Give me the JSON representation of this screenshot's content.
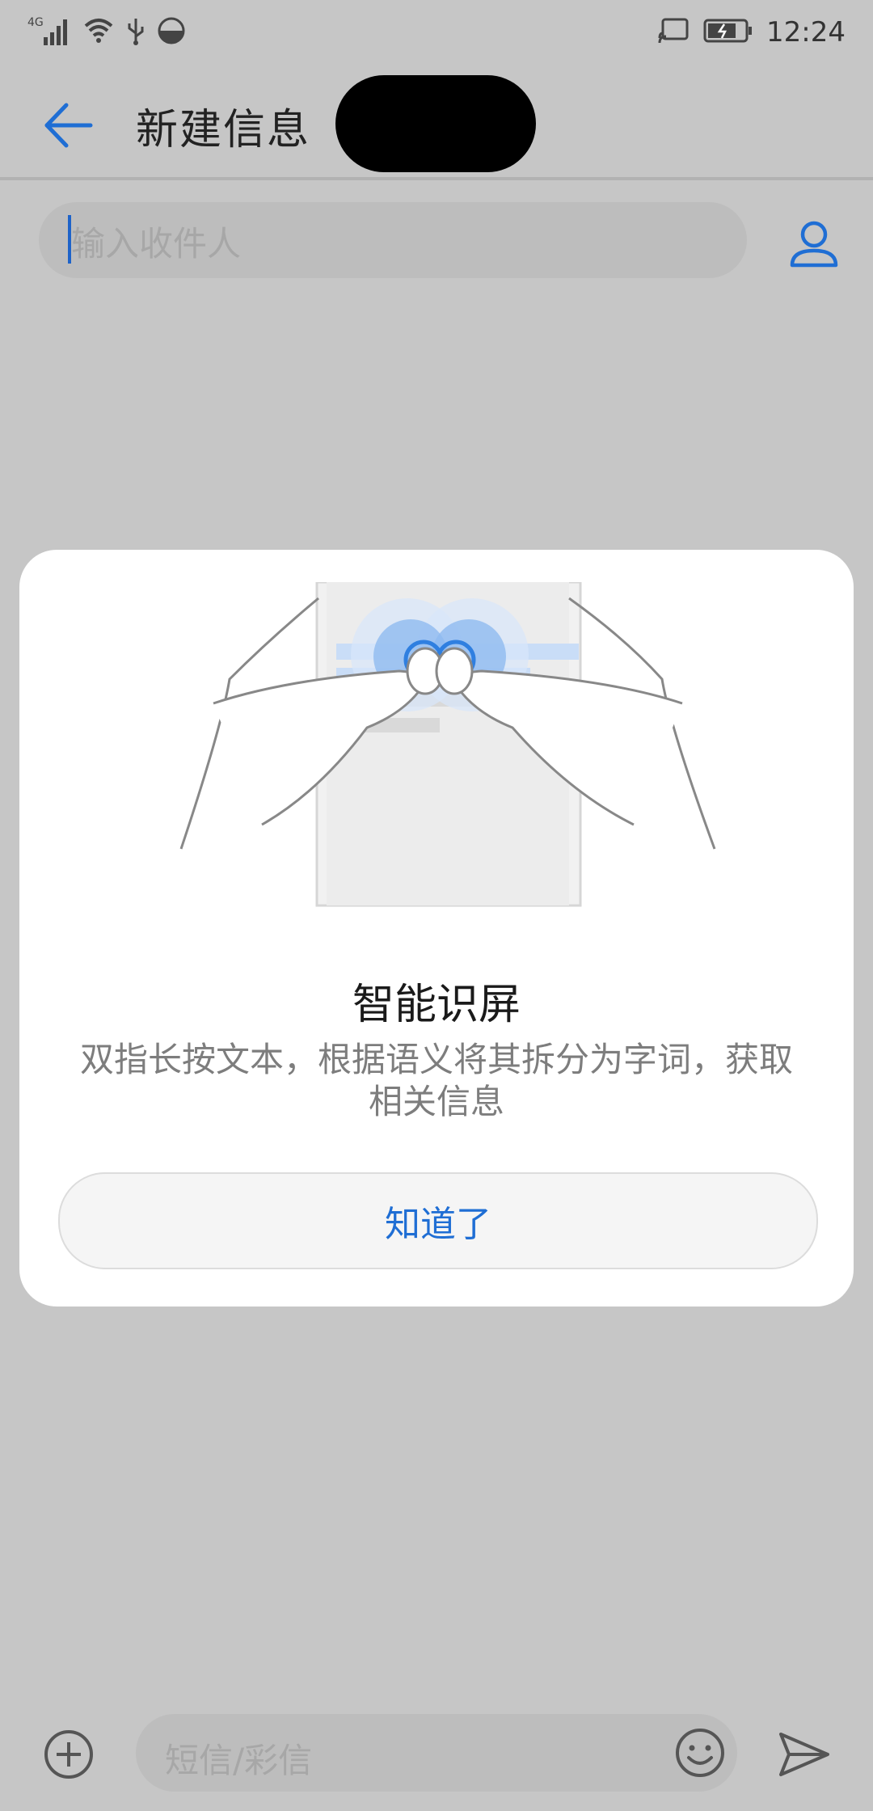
{
  "status_bar": {
    "network": "4G",
    "time": "12:24"
  },
  "header": {
    "title": "新建信息"
  },
  "recipient": {
    "placeholder": "输入收件人"
  },
  "dialog": {
    "title": "智能识屏",
    "description": "双指长按文本，根据语义将其拆分为字词，获取相关信息",
    "ok_label": "知道了"
  },
  "composer": {
    "placeholder": "短信/彩信"
  },
  "colors": {
    "accent": "#1f6ed4",
    "overlay": "#c6c6c6",
    "dialog_bg": "#ffffff"
  },
  "icons": [
    "signal-icon",
    "wifi-icon",
    "usb-icon",
    "data-saver-icon",
    "cast-icon",
    "battery-icon",
    "back-arrow-icon",
    "contact-icon",
    "add-icon",
    "emoji-icon",
    "send-icon"
  ]
}
